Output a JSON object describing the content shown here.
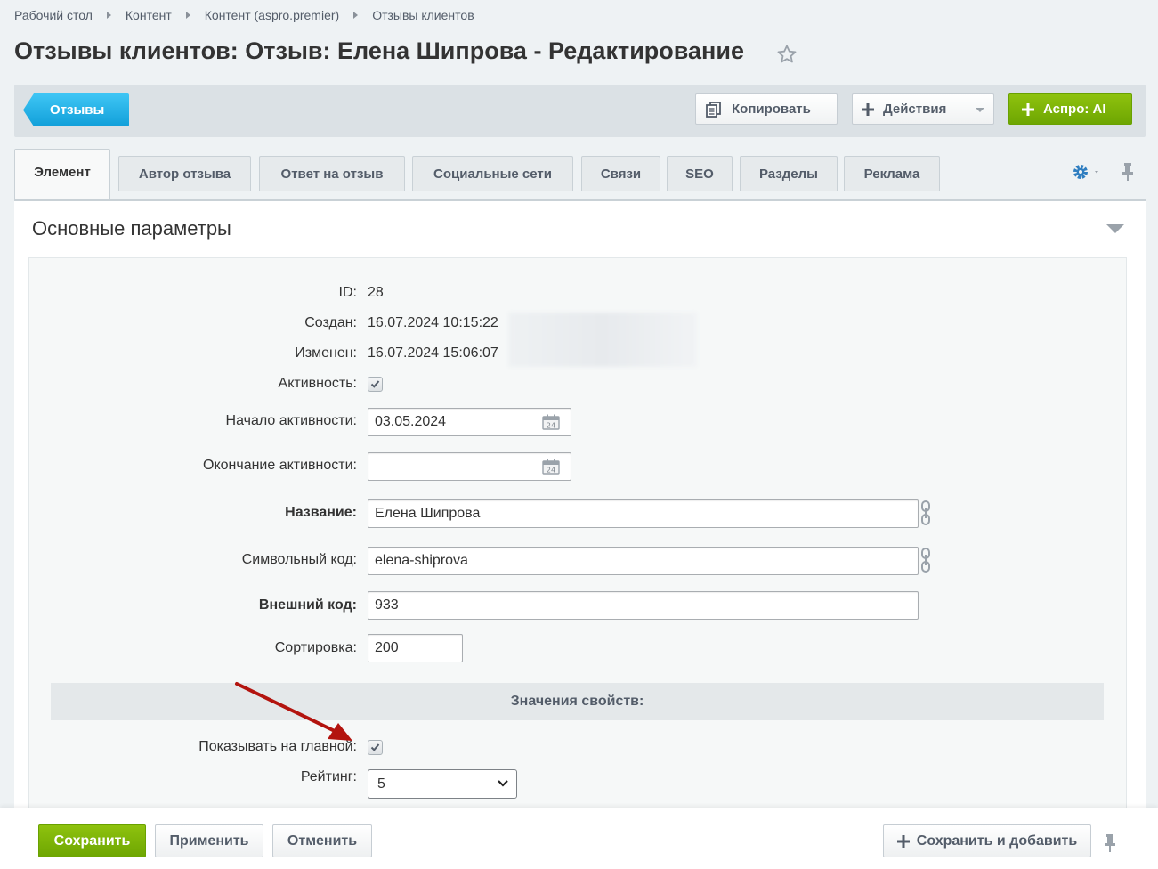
{
  "breadcrumb": [
    "Рабочий стол",
    "Контент",
    "Контент (aspro.premier)",
    "Отзывы клиентов"
  ],
  "page_title": "Отзывы клиентов: Отзыв: Елена Шипрова - Редактирование",
  "toolbar": {
    "back_label": "Отзывы",
    "copy_label": "Копировать",
    "actions_label": "Действия",
    "ai_label": "Аспро: AI"
  },
  "tabs": [
    {
      "label": "Элемент",
      "active": true
    },
    {
      "label": "Автор отзыва"
    },
    {
      "label": "Ответ на отзыв"
    },
    {
      "label": "Социальные сети"
    },
    {
      "label": "Связи"
    },
    {
      "label": "SEO"
    },
    {
      "label": "Разделы"
    },
    {
      "label": "Реклама"
    }
  ],
  "section": {
    "title": "Основные параметры",
    "fields": {
      "id_label": "ID:",
      "id_value": "28",
      "created_label": "Создан:",
      "created_value": "16.07.2024 10:15:22",
      "modified_label": "Изменен:",
      "modified_value": "16.07.2024 15:06:07",
      "active_label": "Активность:",
      "active_from_label": "Начало активности:",
      "active_from_value": "03.05.2024",
      "active_to_label": "Окончание активности:",
      "active_to_value": "",
      "name_label": "Название:",
      "name_value": "Елена Шипрова",
      "code_label": "Символьный код:",
      "code_value": "elena-shiprova",
      "xml_id_label": "Внешний код:",
      "xml_id_value": "933",
      "sort_label": "Сортировка:",
      "sort_value": "200"
    },
    "props_header": "Значения свойств:",
    "props": {
      "show_main_label": "Показывать на главной:",
      "rating_label": "Рейтинг:",
      "rating_value": "5"
    }
  },
  "footer": {
    "save_label": "Сохранить",
    "apply_label": "Применить",
    "cancel_label": "Отменить",
    "save_add_label": "Сохранить и добавить"
  },
  "colors": {
    "accent_green": "#7bb409",
    "back_blue": "#1fb5ec",
    "annotation_arrow": "#b3140f"
  }
}
